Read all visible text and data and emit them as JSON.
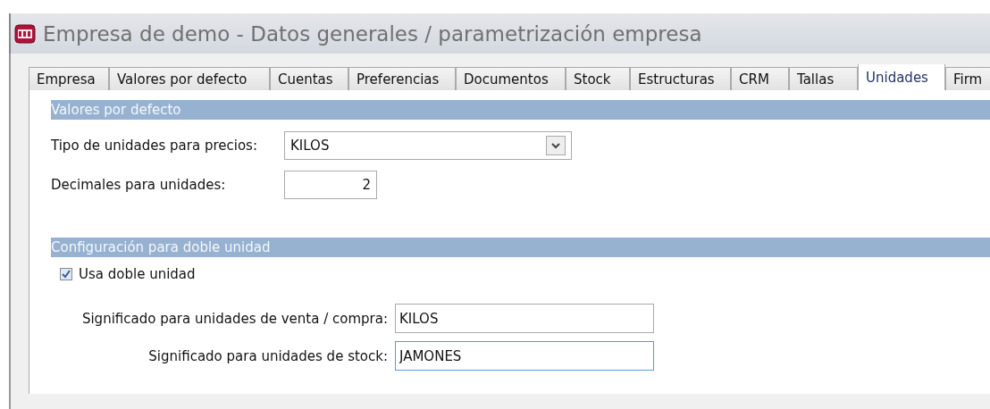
{
  "window": {
    "title": "Empresa de demo - Datos generales / parametrización empresa"
  },
  "tabs": [
    {
      "label": "Empresa",
      "selected": false
    },
    {
      "label": "Valores por defecto",
      "selected": false
    },
    {
      "label": "Cuentas",
      "selected": false
    },
    {
      "label": "Preferencias",
      "selected": false
    },
    {
      "label": "Documentos",
      "selected": false
    },
    {
      "label": "Stock",
      "selected": false
    },
    {
      "label": "Estructuras",
      "selected": false
    },
    {
      "label": "CRM",
      "selected": false
    },
    {
      "label": "Tallas",
      "selected": false
    },
    {
      "label": "Unidades",
      "selected": true
    },
    {
      "label": "Firm",
      "selected": false
    }
  ],
  "defaults": {
    "header": "Valores por defecto",
    "price_unit_label": "Tipo de unidades para precios:",
    "price_unit_value": "KILOS",
    "decimals_label": "Decimales para unidades:",
    "decimals_value": "2"
  },
  "double_unit": {
    "header": "Configuración para doble unidad",
    "checkbox_label": "Usa doble unidad",
    "checked": true,
    "fields": [
      {
        "label": "Significado para unidades de venta / compra:",
        "value": "KILOS",
        "focused": false
      },
      {
        "label": "Significado para unidades de stock:",
        "value": "JAMONES",
        "focused": true
      }
    ]
  }
}
